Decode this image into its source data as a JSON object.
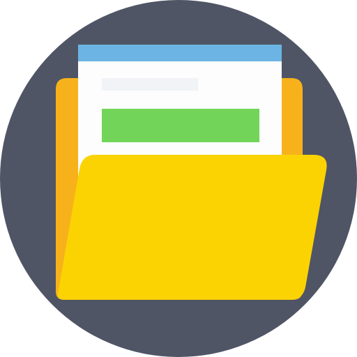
{
  "icon": {
    "name": "open-folder-with-document-icon",
    "colors": {
      "circle_background": "#4F5565",
      "folder_back": "#F7B21B",
      "folder_front": "#FBD303",
      "document_paper": "#FDFDFD",
      "document_header_bar": "#6CB4E4",
      "document_text_line": "#F1F3F6",
      "document_green_block": "#72D55A"
    }
  }
}
